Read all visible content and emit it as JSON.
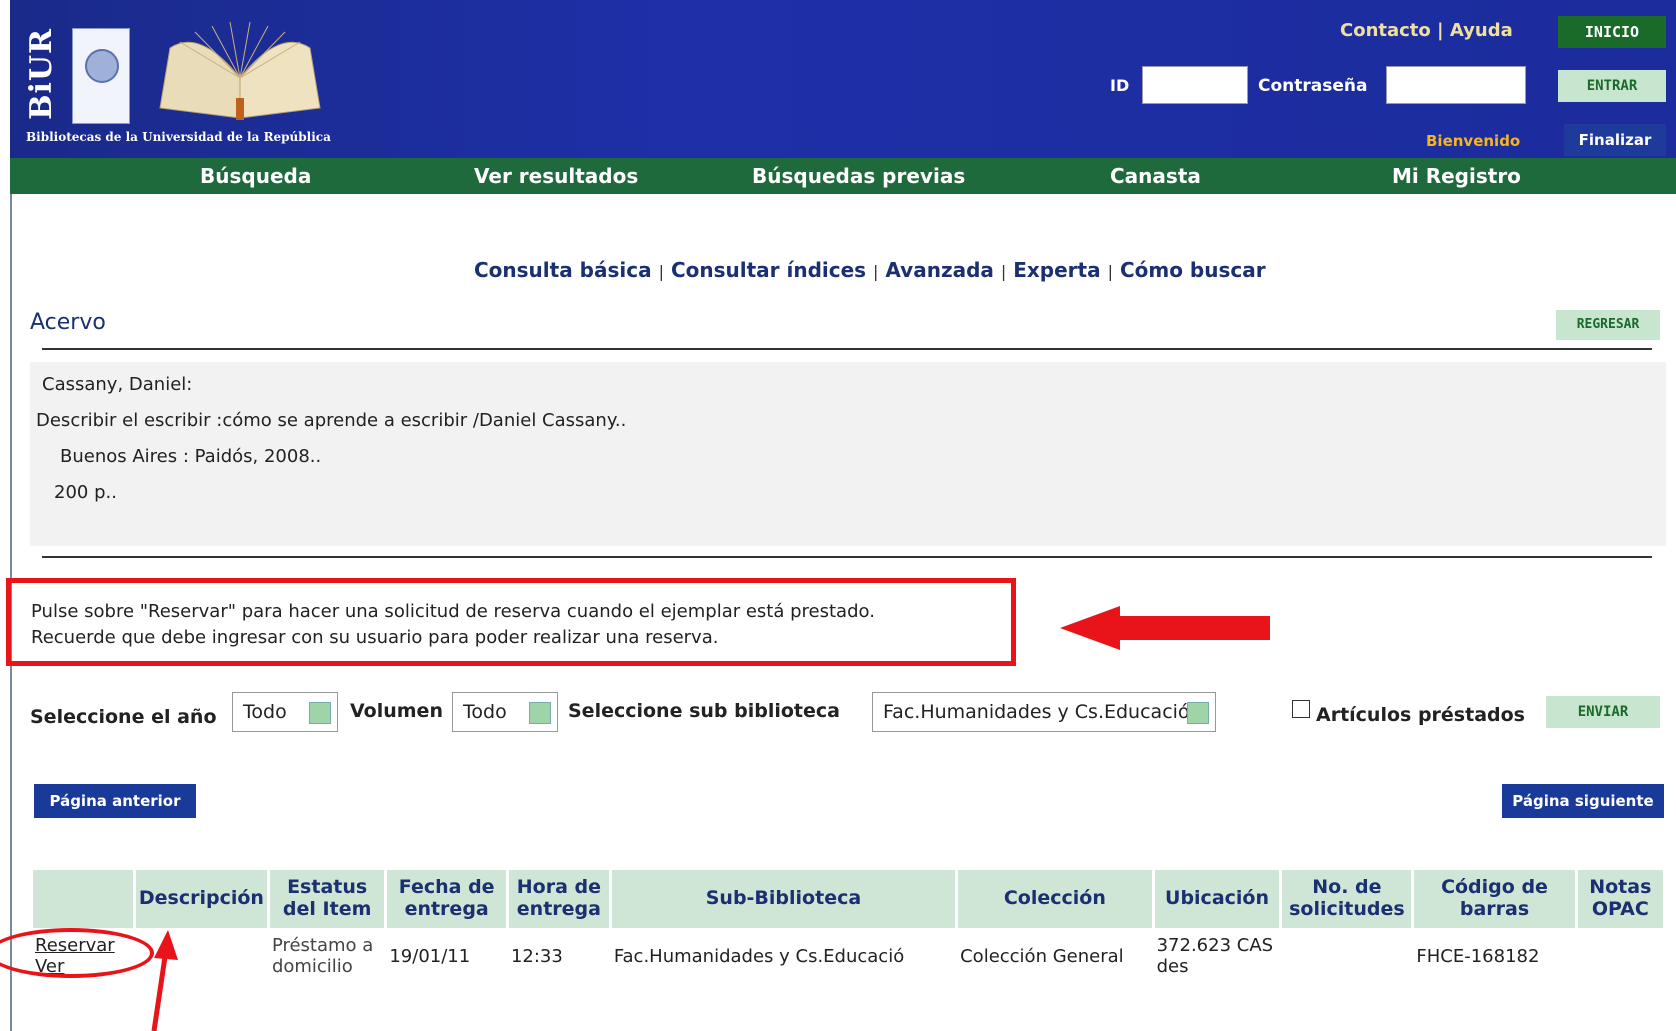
{
  "header": {
    "logo_text": "BiUR",
    "university_name": "Bibliotecas de la Universidad de la República",
    "top_links": "Contacto | Ayuda",
    "inicio_label": "INICIO",
    "id_label": "ID",
    "password_label": "Contraseña",
    "entrar_label": "ENTRAR",
    "welcome_text": "Bienvenido",
    "finalizar_label": "Finalizar"
  },
  "nav": {
    "items": [
      {
        "label": "Búsqueda"
      },
      {
        "label": "Ver resultados"
      },
      {
        "label": "Búsquedas previas"
      },
      {
        "label": "Canasta"
      },
      {
        "label": "Mi Registro"
      }
    ]
  },
  "subnav": {
    "items": [
      "Consulta básica",
      "Consultar índices",
      "Avanzada",
      "Experta",
      "Cómo buscar"
    ],
    "separator": "|"
  },
  "page": {
    "title": "Acervo",
    "regresar_label": "REGRESAR"
  },
  "record": {
    "author": "Cassany, Daniel:",
    "title": "Describir el escribir :cómo se aprende a escribir /Daniel Cassany..",
    "publisher": "Buenos Aires : Paidós, 2008..",
    "pages": "200 p.."
  },
  "notice": {
    "line1": "Pulse sobre \"Reservar\" para hacer una solicitud de reserva cuando el ejemplar está prestado.",
    "line2": "Recuerde que debe ingresar con su usuario para poder realizar una reserva."
  },
  "filters": {
    "year_label": "Seleccione el año",
    "year_value": "Todo",
    "volume_label": "Volumen",
    "volume_value": "Todo",
    "sublibrary_label": "Seleccione sub biblioteca",
    "sublibrary_value": "Fac.Humanidades y Cs.Educació",
    "loaned_label": "Artículos préstados",
    "enviar_label": "ENVIAR"
  },
  "pagination": {
    "prev_label": "Página anterior",
    "next_label": "Página siguiente"
  },
  "table": {
    "headers": [
      "",
      "Descripción",
      "Estatus del Item",
      "Fecha de entrega",
      "Hora de entrega",
      "Sub-Biblioteca",
      "Colección",
      "Ubicación",
      "No. de solicitudes",
      "Código de barras",
      "Notas OPAC"
    ],
    "rows": [
      {
        "reservar": "Reservar",
        "ver": "Ver",
        "descripcion": "",
        "estatus": "Préstamo a domicilio",
        "fecha": "19/01/11",
        "hora": "12:33",
        "sub_biblioteca": "Fac.Humanidades y Cs.Educació",
        "coleccion": "Colección General",
        "ubicacion": "372.623 CAS des",
        "solicitudes": "",
        "codigo": "FHCE-168182",
        "notas": ""
      }
    ]
  },
  "colors": {
    "header_blue": "#1e2fa8",
    "nav_green": "#1f6a3c",
    "accent_red": "#e8141a",
    "table_header": "#cfe6d6"
  }
}
